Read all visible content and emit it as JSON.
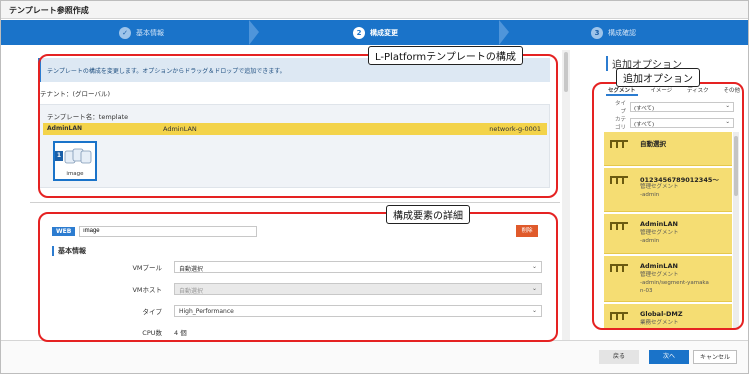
{
  "window": {
    "title": "テンプレート参照作成"
  },
  "steps": [
    {
      "num": "✓",
      "label": "基本情報",
      "state": "done"
    },
    {
      "num": "2",
      "label": "構成変更",
      "state": "active"
    },
    {
      "num": "3",
      "label": "構成確認",
      "state": "inactive"
    }
  ],
  "composition": {
    "banner": "テンプレートの構成を変更します。オプションからドラッグ＆ドロップで追加できます。",
    "tenant": "テナント：(グローバル)",
    "template_name": "テンプレート名：template",
    "lan_tag": "AdminLAN",
    "lan_name": "AdminLAN",
    "lan_network": "network-g-0001",
    "image_num": "1",
    "image_label": "image"
  },
  "detail": {
    "web_tag": "WEB",
    "web_value": "image",
    "delete_label": "削除",
    "section_title": "基本情報",
    "fields": [
      {
        "label": "VMプール",
        "value": "自動選択",
        "disabled": false
      },
      {
        "label": "VMホスト",
        "value": "自動選択",
        "disabled": true
      },
      {
        "label": "タイプ",
        "value": "High_Performance",
        "disabled": false
      }
    ],
    "cpu_label": "CPU数",
    "cpu_value": "4 個"
  },
  "options": {
    "title": "追加オプション",
    "tabs": [
      "セグメント",
      "イメージ",
      "ディスク",
      "その他"
    ],
    "type_label": "タイプ",
    "type_value": "(すべて)",
    "category_label": "カテゴリ",
    "category_value": "(すべて)",
    "cards": [
      {
        "name": "自動選択",
        "sub": ""
      },
      {
        "name": "0123456789012345～",
        "sub": "管理セグメント\n-admin"
      },
      {
        "name": "AdminLAN",
        "sub": "管理セグメント\n-admin"
      },
      {
        "name": "AdminLAN",
        "sub": "管理セグメント\n-admin/segment-yamaka\nn-03"
      },
      {
        "name": "Global-DMZ",
        "sub": "業務セグメント"
      }
    ]
  },
  "footer": {
    "back": "戻る",
    "next": "次へ",
    "cancel": "キャンセル"
  },
  "annotations": {
    "composition": "L-Platformテンプレートの構成",
    "options": "追加オプション",
    "detail": "構成要素の詳細"
  }
}
